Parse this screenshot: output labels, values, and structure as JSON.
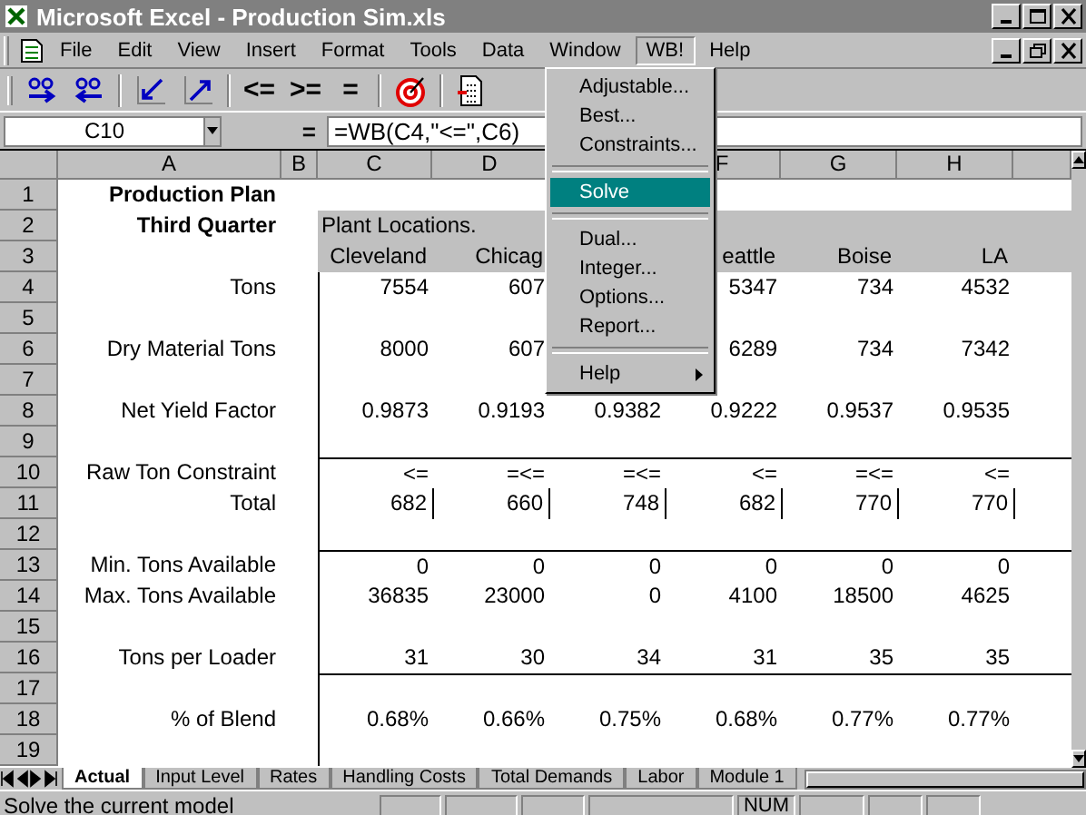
{
  "window": {
    "title": "Microsoft Excel - Production Sim.xls"
  },
  "menu": {
    "items": [
      {
        "label": "File",
        "selected": false
      },
      {
        "label": "Edit",
        "selected": false
      },
      {
        "label": "View",
        "selected": false
      },
      {
        "label": "Insert",
        "selected": false
      },
      {
        "label": "Format",
        "selected": false
      },
      {
        "label": "Tools",
        "selected": false
      },
      {
        "label": "Data",
        "selected": false
      },
      {
        "label": "Window",
        "selected": false
      },
      {
        "label": "WB!",
        "selected": true
      },
      {
        "label": "Help",
        "selected": false
      }
    ]
  },
  "toolbar": {
    "operators": [
      "<=",
      ">=",
      "="
    ]
  },
  "formula_bar": {
    "name_box": "C10",
    "equals": "=",
    "formula": "=WB(C4,\"<=\",C6)"
  },
  "dropdown": {
    "items": [
      {
        "kind": "item",
        "label": "Adjustable...",
        "selected": false
      },
      {
        "kind": "item",
        "label": "Best...",
        "selected": false
      },
      {
        "kind": "item",
        "label": "Constraints...",
        "selected": false
      },
      {
        "kind": "separator"
      },
      {
        "kind": "item",
        "label": "Solve",
        "selected": true
      },
      {
        "kind": "separator"
      },
      {
        "kind": "item",
        "label": "Dual...",
        "selected": false
      },
      {
        "kind": "item",
        "label": "Integer...",
        "selected": false
      },
      {
        "kind": "item",
        "label": "Options...",
        "selected": false
      },
      {
        "kind": "item",
        "label": "Report...",
        "selected": false
      },
      {
        "kind": "separator"
      },
      {
        "kind": "submenu",
        "label": "Help",
        "selected": false
      }
    ]
  },
  "sheet": {
    "columns": [
      "A",
      "B",
      "C",
      "D",
      null,
      "F",
      "G",
      "H",
      null
    ],
    "rows": [
      {
        "number": "1",
        "kind": "title",
        "cells": [
          "Production Plan",
          null,
          null,
          null,
          null,
          null,
          null,
          null,
          null
        ]
      },
      {
        "number": "2",
        "kind": "group",
        "cells": [
          "Third Quarter",
          null,
          "Plant Locations.",
          null,
          null,
          null,
          null,
          null,
          null
        ]
      },
      {
        "number": "3",
        "kind": "header",
        "cells": [
          null,
          null,
          "Cleveland",
          "Chicag",
          null,
          "eattle",
          "Boise",
          "LA",
          null
        ]
      },
      {
        "number": "4",
        "kind": "data",
        "cells": [
          "Tons",
          null,
          "7554",
          "607",
          null,
          "5347",
          "734",
          "4532",
          null
        ]
      },
      {
        "number": "5",
        "kind": "data",
        "cells": [
          null,
          null,
          null,
          null,
          null,
          null,
          null,
          null,
          null
        ]
      },
      {
        "number": "6",
        "kind": "data",
        "cells": [
          "Dry Material Tons",
          null,
          "8000",
          "607",
          null,
          "6289",
          "734",
          "7342",
          null
        ]
      },
      {
        "number": "7",
        "kind": "data",
        "cells": [
          null,
          null,
          null,
          null,
          null,
          null,
          null,
          null,
          null
        ]
      },
      {
        "number": "8",
        "kind": "data",
        "cells": [
          "Net Yield Factor",
          null,
          "0.9873",
          "0.9193",
          "0.9382",
          "0.9222",
          "0.9537",
          "0.9535",
          null
        ]
      },
      {
        "number": "9",
        "kind": "data",
        "cells": [
          null,
          null,
          null,
          null,
          null,
          null,
          null,
          null,
          null
        ]
      },
      {
        "number": "10",
        "kind": "data",
        "rule_above": true,
        "cells": [
          "Raw Ton Constraint",
          null,
          "<=",
          "=<=",
          "=<=",
          "<=",
          "=<=",
          "<=",
          null
        ]
      },
      {
        "number": "11",
        "kind": "data",
        "boxed": true,
        "cells": [
          "Total",
          null,
          "682",
          "660",
          "748",
          "682",
          "770",
          "770",
          null
        ]
      },
      {
        "number": "12",
        "kind": "data",
        "cells": [
          null,
          null,
          null,
          null,
          null,
          null,
          null,
          null,
          null
        ]
      },
      {
        "number": "13",
        "kind": "data",
        "rule_above": true,
        "cells": [
          "Min. Tons Available",
          null,
          "0",
          "0",
          "0",
          "0",
          "0",
          "0",
          null
        ]
      },
      {
        "number": "14",
        "kind": "data",
        "cells": [
          "Max. Tons Available",
          null,
          "36835",
          "23000",
          "0",
          "4100",
          "18500",
          "4625",
          null
        ]
      },
      {
        "number": "15",
        "kind": "data",
        "cells": [
          null,
          null,
          null,
          null,
          null,
          null,
          null,
          null,
          null
        ]
      },
      {
        "number": "16",
        "kind": "data",
        "cells": [
          "Tons per Loader",
          null,
          "31",
          "30",
          "34",
          "31",
          "35",
          "35",
          null
        ]
      },
      {
        "number": "17",
        "kind": "data",
        "rule_above": true,
        "cells": [
          null,
          null,
          null,
          null,
          null,
          null,
          null,
          null,
          null
        ]
      },
      {
        "number": "18",
        "kind": "data",
        "cells": [
          "% of Blend",
          null,
          "0.68%",
          "0.66%",
          "0.75%",
          "0.68%",
          "0.77%",
          "0.77%",
          null
        ]
      },
      {
        "number": "19",
        "kind": "data",
        "cells": [
          null,
          null,
          null,
          null,
          null,
          null,
          null,
          null,
          null
        ]
      }
    ]
  },
  "sheet_tabs": [
    {
      "label": "Actual",
      "selected": true
    },
    {
      "label": "Input Level",
      "selected": false
    },
    {
      "label": "Rates",
      "selected": false
    },
    {
      "label": "Handling Costs",
      "selected": false
    },
    {
      "label": "Total Demands",
      "selected": false
    },
    {
      "label": "Labor",
      "selected": false
    },
    {
      "label": "Module 1",
      "selected": false
    }
  ],
  "status_bar": {
    "message": "Solve the current model",
    "indicator": "NUM"
  }
}
